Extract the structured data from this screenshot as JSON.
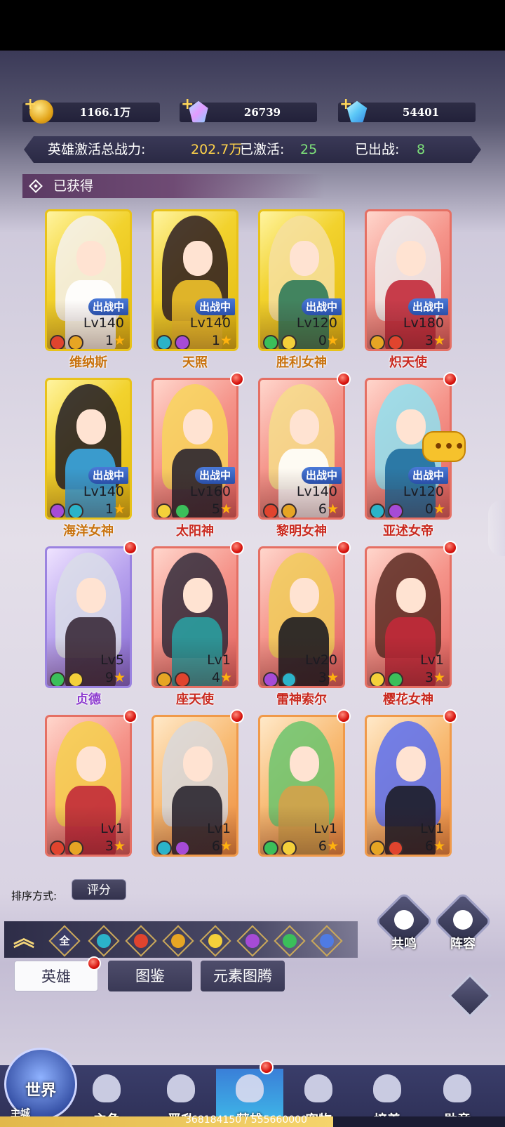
{
  "resources": [
    {
      "icon": "gold-coin-icon",
      "value": "1166.1万"
    },
    {
      "icon": "purple-crystal-icon",
      "value": "26739"
    },
    {
      "icon": "blue-diamond-icon",
      "value": "54401"
    }
  ],
  "power": {
    "label": "英雄激活总战力:",
    "value": "202.7万",
    "activated_label": "已激活:",
    "activated": "25",
    "deployed_label": "已出战:",
    "deployed": "8"
  },
  "section_title": "已获得",
  "heroes": [
    {
      "name": "维纳斯",
      "level": "Lv140",
      "stars": "1",
      "status": "出战中",
      "rarity": "gold"
    },
    {
      "name": "天照",
      "level": "Lv140",
      "stars": "1",
      "status": "出战中",
      "rarity": "gold"
    },
    {
      "name": "胜利女神",
      "level": "Lv120",
      "stars": "0",
      "status": "出战中",
      "rarity": "gold"
    },
    {
      "name": "炽天使",
      "level": "Lv180",
      "stars": "3",
      "status": "出战中",
      "rarity": "red"
    },
    {
      "name": "海洋女神",
      "level": "Lv140",
      "stars": "1",
      "status": "出战中",
      "rarity": "gold"
    },
    {
      "name": "太阳神",
      "level": "Lv160",
      "stars": "5",
      "status": "出战中",
      "rarity": "red"
    },
    {
      "name": "黎明女神",
      "level": "Lv140",
      "stars": "6",
      "status": "出战中",
      "rarity": "red"
    },
    {
      "name": "亚述女帝",
      "level": "Lv120",
      "stars": "0",
      "status": "出战中",
      "rarity": "red"
    },
    {
      "name": "贞德",
      "level": "Lv5",
      "stars": "9",
      "status": "",
      "rarity": "purple"
    },
    {
      "name": "座天使",
      "level": "Lv1",
      "stars": "4",
      "status": "",
      "rarity": "red"
    },
    {
      "name": "雷神索尔",
      "level": "Lv20",
      "stars": "3",
      "status": "",
      "rarity": "red"
    },
    {
      "name": "樱花女神",
      "level": "Lv1",
      "stars": "3",
      "status": "",
      "rarity": "red"
    },
    {
      "name": "",
      "level": "Lv1",
      "stars": "3",
      "status": "",
      "rarity": "red"
    },
    {
      "name": "",
      "level": "Lv1",
      "stars": "6",
      "status": "",
      "rarity": "orange"
    },
    {
      "name": "",
      "level": "Lv1",
      "stars": "6",
      "status": "",
      "rarity": "orange"
    },
    {
      "name": "",
      "level": "Lv1",
      "stars": "6",
      "status": "",
      "rarity": "orange"
    }
  ],
  "sort": {
    "label": "排序方式:",
    "value": "评分"
  },
  "filters": [
    "全"
  ],
  "right_buttons": {
    "resonance": "共鸣",
    "lineup": "阵容"
  },
  "tabs": {
    "heroes": "英雄",
    "codex": "图鉴",
    "totem": "元素图腾"
  },
  "nav": {
    "world": "世界",
    "main_city": "主城",
    "items": [
      "主角",
      "晋升",
      "英雄",
      "宠物",
      "培养",
      "勋章"
    ]
  },
  "exp_text": "368184150 / 555660000",
  "exp_progress": 0.66
}
